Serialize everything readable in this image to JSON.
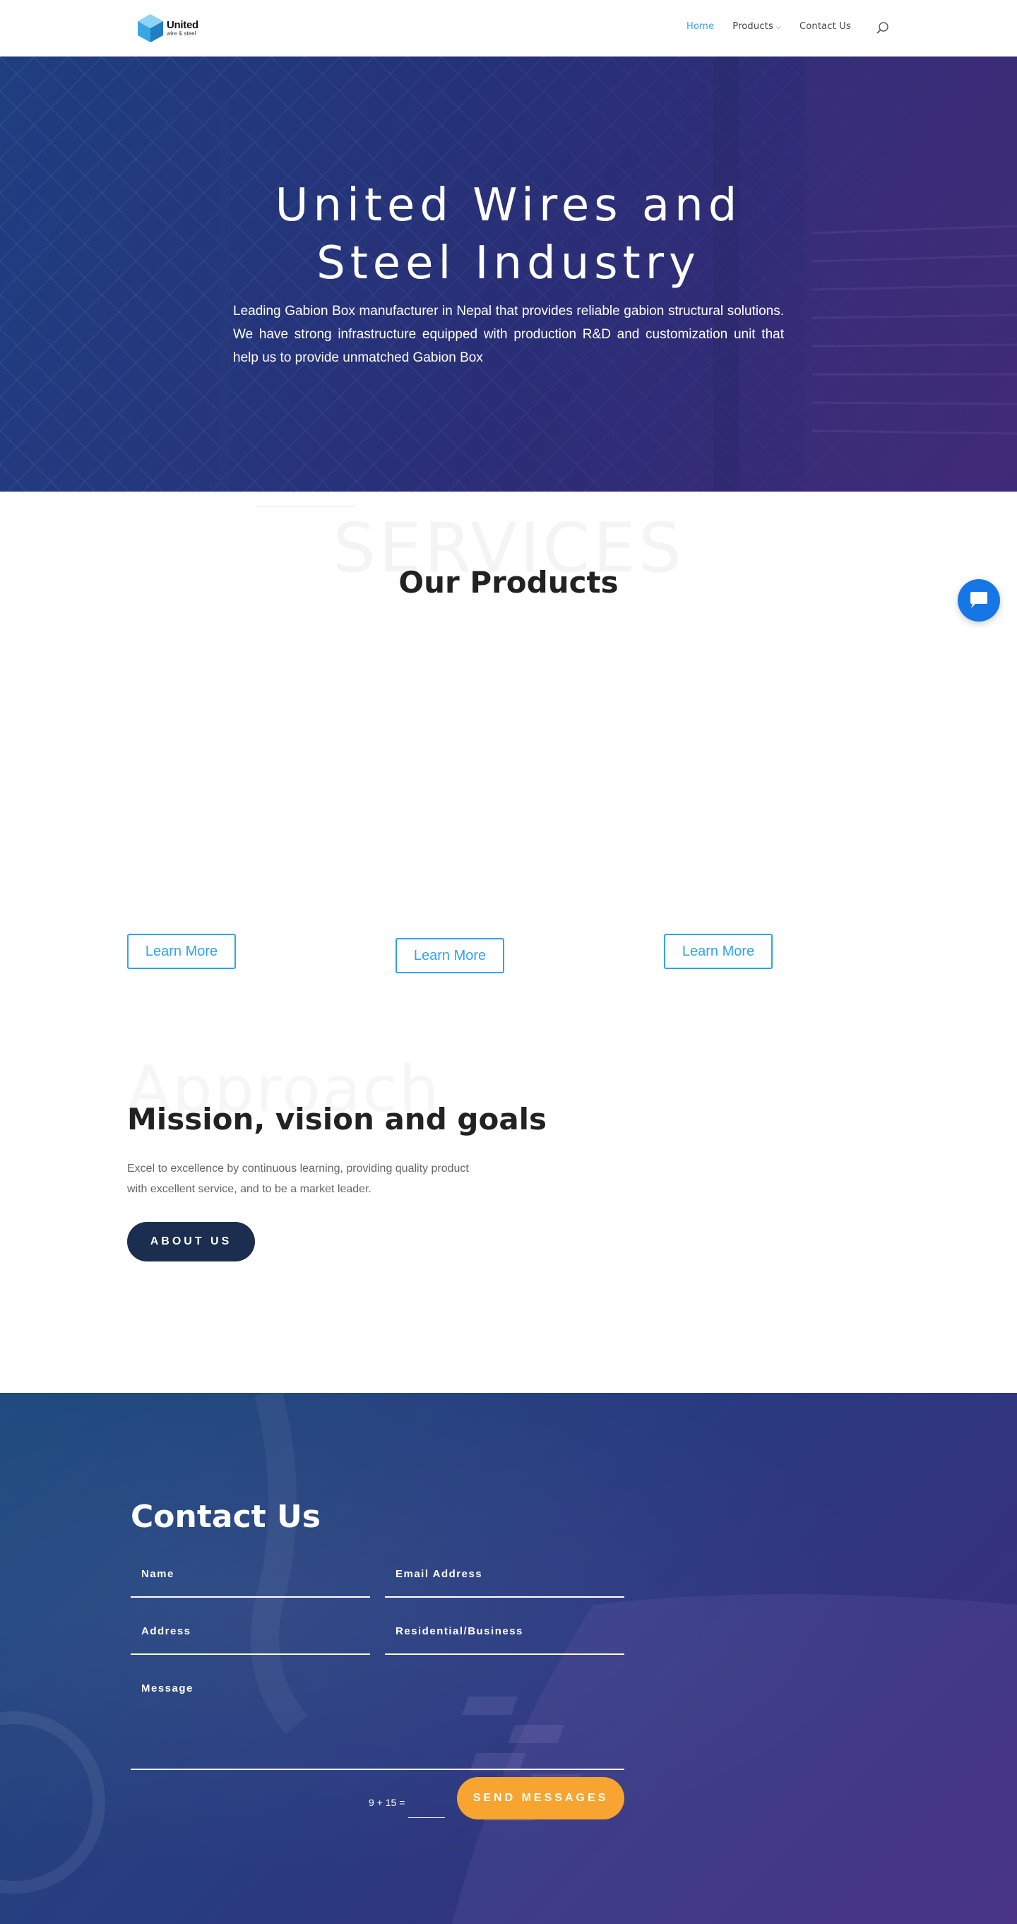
{
  "header": {
    "logo_name": "United",
    "logo_sub": "wire & steel",
    "nav": [
      {
        "label": "Home",
        "active": true
      },
      {
        "label": "Products",
        "has_dropdown": true
      },
      {
        "label": "Contact Us"
      }
    ]
  },
  "hero": {
    "title": "United Wires and Steel Industry",
    "text": "Leading Gabion Box manufacturer in Nepal that provides reliable gabion structural solutions. We have strong infrastructure equipped with production R&D and customization unit that help us to provide unmatched Gabion Box"
  },
  "products": {
    "bg_word": "SERVICES",
    "title": "Our Products",
    "buttons": [
      "Learn More",
      "Learn More",
      "Learn More"
    ]
  },
  "approach": {
    "bg_word": "Approach",
    "title": "Mission, vision and goals",
    "text": "Excel to excellence by continuous learning, providing quality product with excellent service, and to be a market leader.",
    "button": "ABOUT US"
  },
  "contact": {
    "title": "Contact Us",
    "fields": {
      "name": "Name",
      "email": "Email Address",
      "address": "Address",
      "type": "Residential/Business",
      "message": "Message"
    },
    "captcha": "9 + 15 =",
    "send": "SEND MESSAGES"
  },
  "colors": {
    "accent": "#2ea3f2",
    "navy_button": "#1b2e4f",
    "orange_button": "#f7a530",
    "chat": "#1776e6"
  }
}
